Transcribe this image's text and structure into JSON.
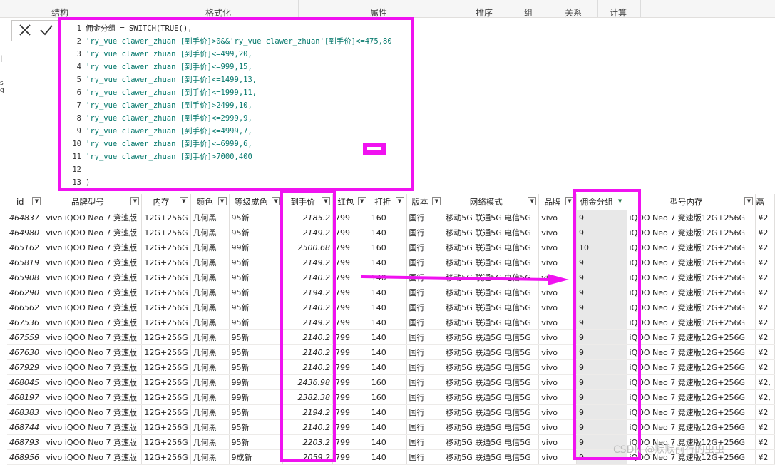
{
  "ribbon": {
    "groups": [
      "结构",
      "格式化",
      "属性",
      "排序",
      "组",
      "关系",
      "计算"
    ]
  },
  "formula_bar": {
    "cancel_icon": "close-icon",
    "commit_icon": "check-icon",
    "left_glyphs": [
      "l",
      "s",
      "g"
    ],
    "lines": [
      {
        "n": "1",
        "text": "佣金分组 = SWITCH(TRUE(),"
      },
      {
        "n": "2",
        "text": "'ry_vue clawer_zhuan'[到手价]>0&&'ry_vue clawer_zhuan'[到手价]<=475,80"
      },
      {
        "n": "3",
        "text": "'ry_vue clawer_zhuan'[到手价]<=499,20,"
      },
      {
        "n": "4",
        "text": "'ry_vue clawer_zhuan'[到手价]<=999,15,"
      },
      {
        "n": "5",
        "text": "'ry_vue clawer_zhuan'[到手价]<=1499,13,"
      },
      {
        "n": "6",
        "text": "'ry_vue clawer_zhuan'[到手价]<=1999,11,"
      },
      {
        "n": "7",
        "text": "'ry_vue clawer_zhuan'[到手价]>2499,10,"
      },
      {
        "n": "8",
        "text": "'ry_vue clawer_zhuan'[到手价]<=2999,9,"
      },
      {
        "n": "9",
        "text": "'ry_vue clawer_zhuan'[到手价]<=4999,7,"
      },
      {
        "n": "10",
        "text": "'ry_vue clawer_zhuan'[到手价]<=6999,6,"
      },
      {
        "n": "11",
        "text": "'ry_vue clawer_zhuan'[到手价]>7000,400"
      },
      {
        "n": "12",
        "text": ""
      },
      {
        "n": "13",
        "text": ")"
      }
    ]
  },
  "table": {
    "columns": [
      "id",
      "品牌型号",
      "内存",
      "颜色",
      "等级成色",
      "到手价",
      "红包",
      "打折",
      "版本",
      "网络模式",
      "品牌",
      "佣金分组",
      "型号内存",
      "磊"
    ],
    "selected_column": "佣金分组",
    "rows": [
      [
        "464837",
        "vivo iQOO Neo 7 竞速版",
        "12G+256G",
        "几何黑",
        "95新",
        "2185.2",
        "799",
        "160",
        "国行",
        "移动5G 联通5G 电信5G",
        "vivo",
        "9",
        "iQOO Neo 7 竞速版12G+256G",
        "¥2"
      ],
      [
        "464980",
        "vivo iQOO Neo 7 竞速版",
        "12G+256G",
        "几何黑",
        "95新",
        "2149.2",
        "799",
        "140",
        "国行",
        "移动5G 联通5G 电信5G",
        "vivo",
        "9",
        "iQOO Neo 7 竞速版12G+256G",
        "¥2"
      ],
      [
        "465162",
        "vivo iQOO Neo 7 竞速版",
        "12G+256G",
        "几何黑",
        "99新",
        "2500.68",
        "799",
        "160",
        "国行",
        "移动5G 联通5G 电信5G",
        "vivo",
        "10",
        "iQOO Neo 7 竞速版12G+256G",
        "¥2"
      ],
      [
        "465819",
        "vivo iQOO Neo 7 竞速版",
        "12G+256G",
        "几何黑",
        "95新",
        "2149.2",
        "799",
        "140",
        "国行",
        "移动5G 联通5G 电信5G",
        "vivo",
        "9",
        "iQOO Neo 7 竞速版12G+256G",
        "¥2"
      ],
      [
        "465908",
        "vivo iQOO Neo 7 竞速版",
        "12G+256G",
        "几何黑",
        "95新",
        "2140.2",
        "799",
        "140",
        "国行",
        "移动5G 联通5G 电信5G",
        "vivo",
        "9",
        "iQOO Neo 7 竞速版12G+256G",
        "¥2"
      ],
      [
        "466290",
        "vivo iQOO Neo 7 竞速版",
        "12G+256G",
        "几何黑",
        "95新",
        "2194.2",
        "799",
        "140",
        "国行",
        "移动5G 联通5G 电信5G",
        "vivo",
        "9",
        "iQOO Neo 7 竞速版12G+256G",
        "¥2"
      ],
      [
        "466562",
        "vivo iQOO Neo 7 竞速版",
        "12G+256G",
        "几何黑",
        "95新",
        "2140.2",
        "799",
        "140",
        "国行",
        "移动5G 联通5G 电信5G",
        "vivo",
        "9",
        "iQOO Neo 7 竞速版12G+256G",
        "¥2"
      ],
      [
        "467536",
        "vivo iQOO Neo 7 竞速版",
        "12G+256G",
        "几何黑",
        "95新",
        "2149.2",
        "799",
        "140",
        "国行",
        "移动5G 联通5G 电信5G",
        "vivo",
        "9",
        "iQOO Neo 7 竞速版12G+256G",
        "¥2"
      ],
      [
        "467559",
        "vivo iQOO Neo 7 竞速版",
        "12G+256G",
        "几何黑",
        "95新",
        "2140.2",
        "799",
        "140",
        "国行",
        "移动5G 联通5G 电信5G",
        "vivo",
        "9",
        "iQOO Neo 7 竞速版12G+256G",
        "¥2"
      ],
      [
        "467630",
        "vivo iQOO Neo 7 竞速版",
        "12G+256G",
        "几何黑",
        "95新",
        "2140.2",
        "799",
        "140",
        "国行",
        "移动5G 联通5G 电信5G",
        "vivo",
        "9",
        "iQOO Neo 7 竞速版12G+256G",
        "¥2"
      ],
      [
        "467929",
        "vivo iQOO Neo 7 竞速版",
        "12G+256G",
        "几何黑",
        "95新",
        "2140.2",
        "799",
        "140",
        "国行",
        "移动5G 联通5G 电信5G",
        "vivo",
        "9",
        "iQOO Neo 7 竞速版12G+256G",
        "¥2"
      ],
      [
        "468045",
        "vivo iQOO Neo 7 竞速版",
        "12G+256G",
        "几何黑",
        "99新",
        "2436.98",
        "799",
        "160",
        "国行",
        "移动5G 联通5G 电信5G",
        "vivo",
        "9",
        "iQOO Neo 7 竞速版12G+256G",
        "¥2,"
      ],
      [
        "468197",
        "vivo iQOO Neo 7 竞速版",
        "12G+256G",
        "几何黑",
        "99新",
        "2382.38",
        "799",
        "160",
        "国行",
        "移动5G 联通5G 电信5G",
        "vivo",
        "9",
        "iQOO Neo 7 竞速版12G+256G",
        "¥2,"
      ],
      [
        "468383",
        "vivo iQOO Neo 7 竞速版",
        "12G+256G",
        "几何黑",
        "95新",
        "2194.2",
        "799",
        "140",
        "国行",
        "移动5G 联通5G 电信5G",
        "vivo",
        "9",
        "iQOO Neo 7 竞速版12G+256G",
        "¥2"
      ],
      [
        "468744",
        "vivo iQOO Neo 7 竞速版",
        "12G+256G",
        "几何黑",
        "95新",
        "2140.2",
        "799",
        "140",
        "国行",
        "移动5G 联通5G 电信5G",
        "vivo",
        "9",
        "iQOO Neo 7 竞速版12G+256G",
        "¥2"
      ],
      [
        "468793",
        "vivo iQOO Neo 7 竞速版",
        "12G+256G",
        "几何黑",
        "95新",
        "2203.2",
        "799",
        "140",
        "国行",
        "移动5G 联通5G 电信5G",
        "vivo",
        "9",
        "iQOO Neo 7 竞速版12G+256G",
        "¥2"
      ],
      [
        "468956",
        "vivo iQOO Neo 7 竞速版",
        "12G+256G",
        "几何黑",
        "9成新",
        "2059.2",
        "799",
        "140",
        "国行",
        "移动5G 联通5G 电信5G",
        "vivo",
        "9",
        "iQOO Neo 7 竞速版12G+256G",
        "¥2"
      ]
    ]
  },
  "annotation": {
    "color": "#f012f0",
    "arrow_from": "到手价",
    "arrow_to": "佣金分组"
  },
  "watermark": "CSDN @默默前行的虫虫"
}
